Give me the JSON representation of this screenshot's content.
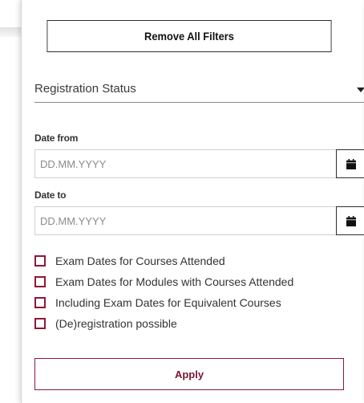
{
  "filters": {
    "remove_all_label": "Remove All Filters",
    "registration_status": {
      "label": "Registration Status"
    },
    "date_from": {
      "label": "Date from",
      "placeholder": "DD.MM.YYYY",
      "value": ""
    },
    "date_to": {
      "label": "Date to",
      "placeholder": "DD.MM.YYYY",
      "value": ""
    },
    "checkboxes": [
      {
        "label": "Exam Dates for Courses Attended",
        "checked": false
      },
      {
        "label": "Exam Dates for Modules with Courses Attended",
        "checked": false
      },
      {
        "label": "Including Exam Dates for Equivalent Courses",
        "checked": false
      },
      {
        "label": "(De)registration possible",
        "checked": false
      }
    ],
    "apply_label": "Apply"
  },
  "icons": {
    "calendar": "calendar-icon",
    "dropdown": "caret-down-icon"
  },
  "colors": {
    "accent": "#8b1a3a",
    "border_dark": "#2e2e2e",
    "border_light": "#cfcfcf"
  }
}
